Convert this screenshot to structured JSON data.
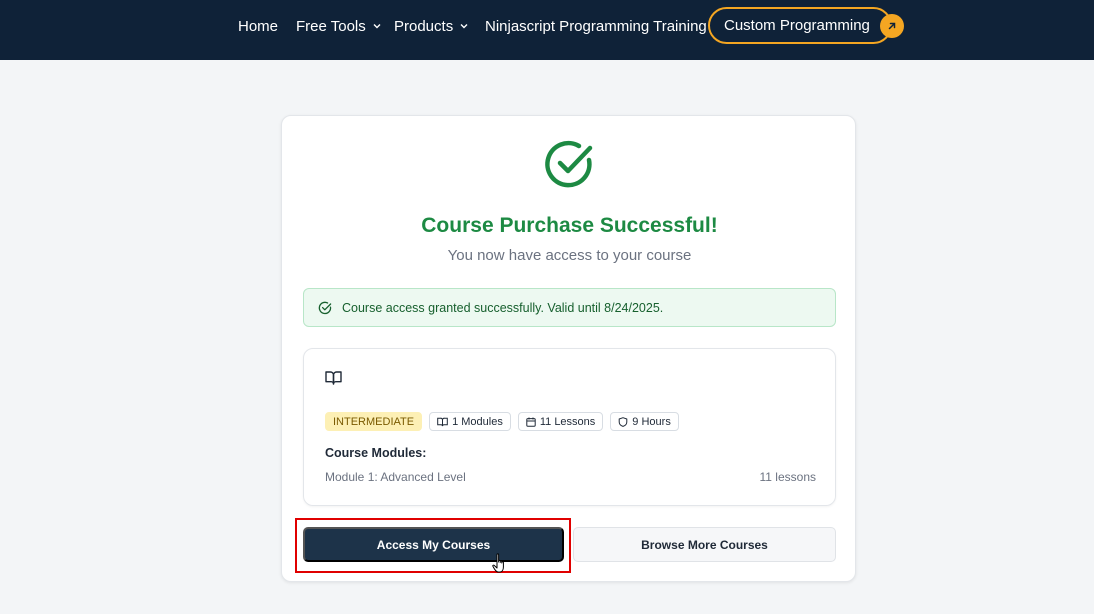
{
  "nav": {
    "items": [
      {
        "label": "Home"
      },
      {
        "label": "Free Tools"
      },
      {
        "label": "Products"
      },
      {
        "label": "Ninjascript Programming Training"
      }
    ],
    "cta_label": "Custom Programming"
  },
  "card": {
    "title": "Course Purchase Successful!",
    "subtitle": "You now have access to your course",
    "alert": "Course access granted successfully. Valid until 8/24/2025.",
    "course": {
      "level": "INTERMEDIATE",
      "modules": "1 Modules",
      "lessons": "11 Lessons",
      "hours": "9 Hours",
      "modules_heading": "Course Modules:",
      "module_list": [
        {
          "name": "Module 1: Advanced Level",
          "lessons": "11 lessons"
        }
      ]
    },
    "buttons": {
      "primary": "Access My Courses",
      "secondary": "Browse More Courses"
    }
  },
  "colors": {
    "nav_bg": "#0f2238",
    "accent": "#f4a622",
    "success": "#1d8a43",
    "primary_button": "#1d3349",
    "highlight_box": "#e00000"
  }
}
